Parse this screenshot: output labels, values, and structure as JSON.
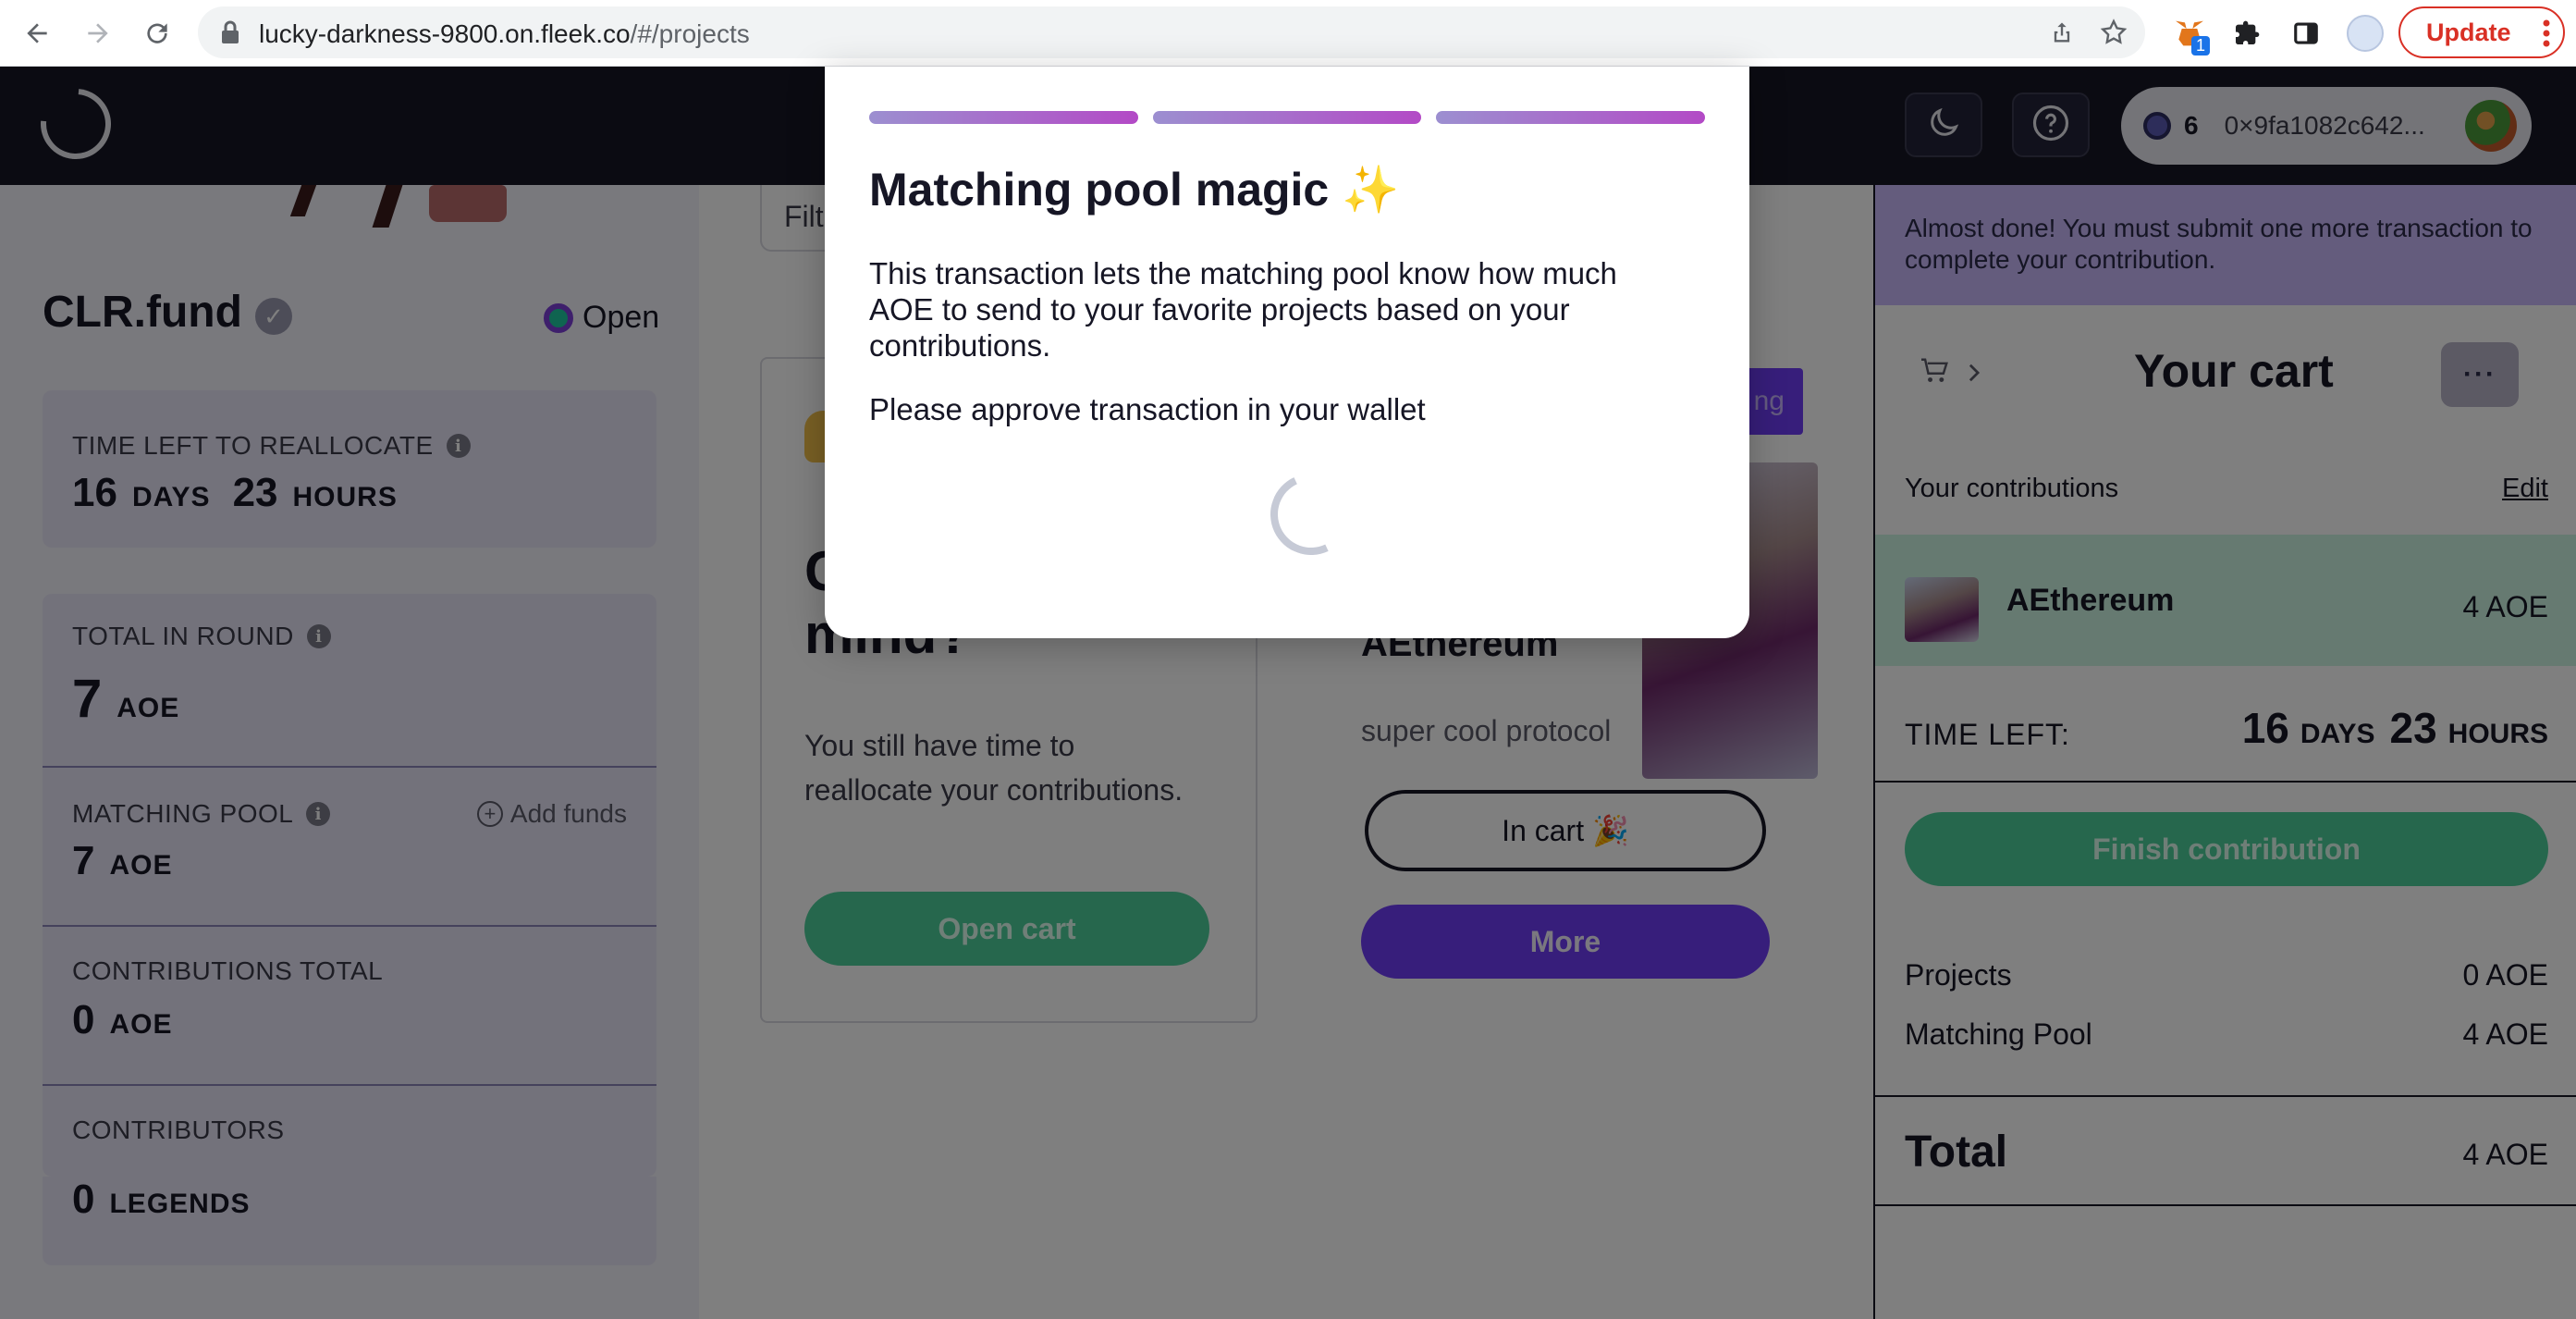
{
  "browser": {
    "url_host": "lucky-darkness-9800.on.fleek.co",
    "url_path": "/#/projects",
    "extension_badge": "1",
    "update_label": "Update"
  },
  "header": {
    "wallet_balance": "6",
    "wallet_address": "0×9fa1082c642..."
  },
  "sidebar": {
    "round_name": "CLR.fund",
    "status": "Open",
    "time_left": {
      "label": "TIME LEFT TO REALLOCATE",
      "days": "16",
      "days_unit": "DAYS",
      "hours": "23",
      "hours_unit": "HOURS"
    },
    "total_in_round": {
      "label": "TOTAL IN ROUND",
      "value": "7",
      "unit": "AOE"
    },
    "matching_pool": {
      "label": "MATCHING POOL",
      "value": "7",
      "unit": "AOE",
      "add_funds": "Add funds"
    },
    "contributions_total": {
      "label": "CONTRIBUTIONS TOTAL",
      "value": "0",
      "unit": "AOE"
    },
    "contributors": {
      "label": "CONTRIBUTORS",
      "value": "0",
      "unit": "LEGENDS"
    }
  },
  "main": {
    "filter_placeholder": "Filt",
    "hero": {
      "title_line1": "C",
      "title_line2": "mind?",
      "text": "You still have time to reallocate your contributions.",
      "button": "Open cart"
    },
    "project": {
      "tag": "ng",
      "name": "AEthereum",
      "description": "super cool protocol",
      "in_cart_button": "In cart 🎉",
      "more_button": "More"
    }
  },
  "cart": {
    "banner": "Almost done! You must submit one more transaction to complete your contribution.",
    "title": "Your cart",
    "more_label": "···",
    "contributions_label": "Your contributions",
    "edit_label": "Edit",
    "item": {
      "name": "AEthereum",
      "amount": "4 AOE"
    },
    "time_left": {
      "label": "TIME LEFT:",
      "days": "16",
      "days_unit": "DAYS",
      "hours": "23",
      "hours_unit": "HOURS"
    },
    "finish_button": "Finish contribution",
    "projects": {
      "label": "Projects",
      "value": "0 AOE"
    },
    "matching_pool": {
      "label": "Matching Pool",
      "value": "4 AOE"
    },
    "total": {
      "label": "Total",
      "value": "4 AOE"
    }
  },
  "modal": {
    "steps_total": 3,
    "title": "Matching pool magic ✨",
    "body": "This transaction lets the matching pool know how much AOE to send to your favorite projects based on your contributions.",
    "approve": "Please approve transaction in your wallet"
  }
}
